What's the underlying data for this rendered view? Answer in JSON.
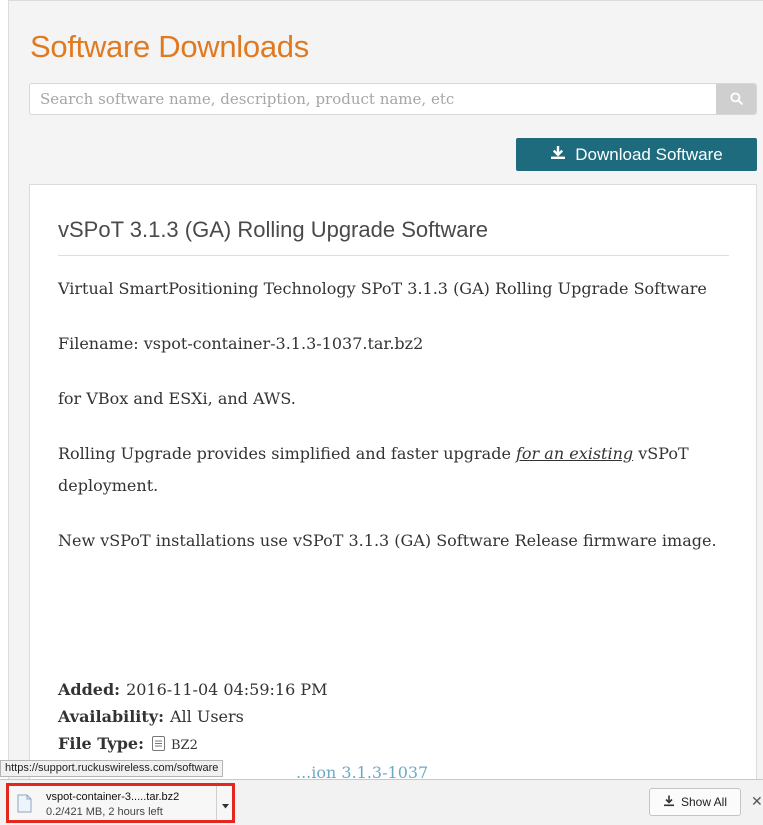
{
  "page": {
    "title": "Software Downloads"
  },
  "search": {
    "placeholder": "Search software name, description, product name, etc",
    "icon": "search-icon"
  },
  "download_button": {
    "label": "Download Software",
    "icon": "download-icon",
    "color": "#1e6b7d"
  },
  "release": {
    "title": "vSPoT 3.1.3 (GA) Rolling Upgrade Software",
    "description": "Virtual SmartPositioning Technology SPoT 3.1.3 (GA) Rolling Upgrade Software",
    "filename": "Filename: vspot-container-3.1.3-1037.tar.bz2",
    "platforms": "for VBox and ESXi, and AWS.",
    "upgrade_text_before": "Rolling Upgrade provides simplified and faster upgrade ",
    "upgrade_emphasis": "for an existing",
    "upgrade_text_after": " vSPoT deployment.",
    "new_install_note": "New vSPoT installations use vSPoT 3.1.3 (GA) Software Release firmware image.",
    "meta": {
      "added_label": "Added:",
      "added_value": "2016-11-04 04:59:16 PM",
      "availability_label": "Availability:",
      "availability_value": "All Users",
      "file_type_label": "File Type:",
      "file_type_value": "BZ2",
      "file_link_partial": "...ion 3.1.3-1037"
    }
  },
  "status_bar": {
    "url": "https://support.ruckuswireless.com/software"
  },
  "download_shelf": {
    "item_name": "vspot-container-3.....tar.bz2",
    "item_progress": "0.2/421 MB, 2 hours left",
    "show_all_label": "Show All",
    "close_glyph": "✕",
    "highlight_color": "#e3261e"
  },
  "colors": {
    "brand_orange": "#e07a21",
    "link_blue": "#6ba9c9"
  }
}
